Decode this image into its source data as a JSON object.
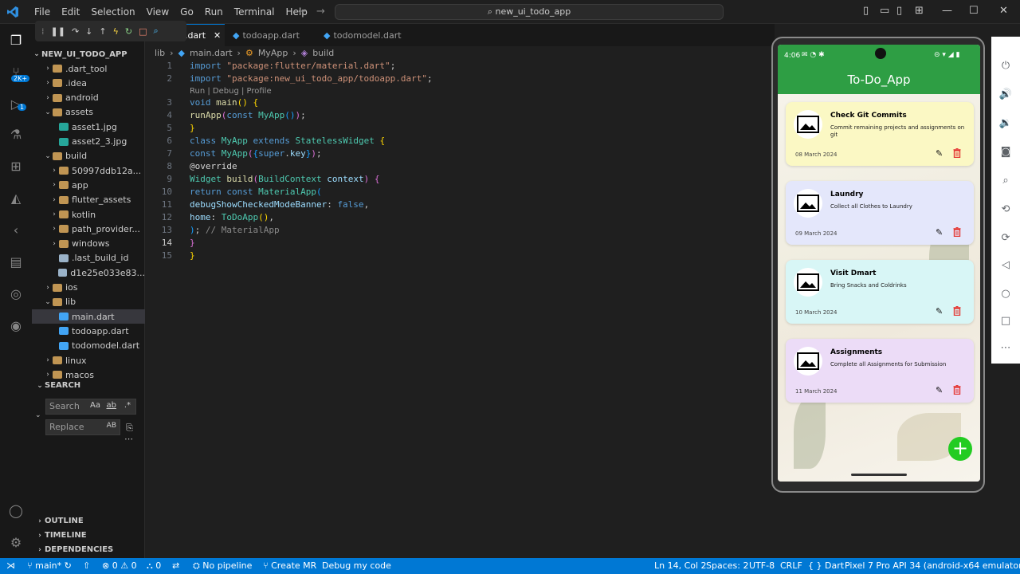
{
  "titlebar": {
    "menu": [
      "File",
      "Edit",
      "Selection",
      "View",
      "Go",
      "Run",
      "Terminal",
      "Help"
    ],
    "command_center": "new_ui_todo_app",
    "back": "←",
    "forward": "→"
  },
  "activity": {
    "badge_scm": "2K+",
    "badge_run": "1"
  },
  "explorer": {
    "root": "NEW_UI_TODO_APP",
    "items": [
      {
        "label": ".dart_tool",
        "depth": 1,
        "folder": true,
        "open": false
      },
      {
        "label": ".idea",
        "depth": 1,
        "folder": true,
        "open": false
      },
      {
        "label": "android",
        "depth": 1,
        "folder": true,
        "open": false
      },
      {
        "label": "assets",
        "depth": 1,
        "folder": true,
        "open": true
      },
      {
        "label": "asset1.jpg",
        "depth": 2,
        "folder": false
      },
      {
        "label": "asset2_3.jpg",
        "depth": 2,
        "folder": false
      },
      {
        "label": "build",
        "depth": 1,
        "folder": true,
        "open": true
      },
      {
        "label": "50997ddb12a...",
        "depth": 2,
        "folder": true,
        "open": false
      },
      {
        "label": "app",
        "depth": 2,
        "folder": true,
        "open": false
      },
      {
        "label": "flutter_assets",
        "depth": 2,
        "folder": true,
        "open": false
      },
      {
        "label": "kotlin",
        "depth": 2,
        "folder": true,
        "open": false
      },
      {
        "label": "path_provider...",
        "depth": 2,
        "folder": true,
        "open": false
      },
      {
        "label": "windows",
        "depth": 2,
        "folder": true,
        "open": false
      },
      {
        "label": ".last_build_id",
        "depth": 2,
        "folder": false
      },
      {
        "label": "d1e25e033e83...",
        "depth": 2,
        "folder": false
      },
      {
        "label": "ios",
        "depth": 1,
        "folder": true,
        "open": false
      },
      {
        "label": "lib",
        "depth": 1,
        "folder": true,
        "open": true
      },
      {
        "label": "main.dart",
        "depth": 2,
        "folder": false,
        "selected": true
      },
      {
        "label": "todoapp.dart",
        "depth": 2,
        "folder": false
      },
      {
        "label": "todomodel.dart",
        "depth": 2,
        "folder": false
      },
      {
        "label": "linux",
        "depth": 1,
        "folder": true,
        "open": false
      },
      {
        "label": "macos",
        "depth": 1,
        "folder": true,
        "open": false
      }
    ]
  },
  "search": {
    "header": "SEARCH",
    "search_placeholder": "Search",
    "replace_placeholder": "Replace",
    "case_btn": "Aa",
    "word_btn": "ab",
    "regex_btn": ".*",
    "preserve_btn": "AB"
  },
  "panels": {
    "outline": "OUTLINE",
    "timeline": "TIMELINE",
    "dependencies": "DEPENDENCIES"
  },
  "tabs": [
    {
      "label": "main.dart",
      "active": true
    },
    {
      "label": "todoapp.dart",
      "active": false
    },
    {
      "label": "todomodel.dart",
      "active": false
    }
  ],
  "breadcrumb": [
    "lib",
    "main.dart",
    "MyApp",
    "build"
  ],
  "code": {
    "codelens": "Run | Debug | Profile",
    "line_numbers": [
      "1",
      "2",
      "3",
      "4",
      "5",
      "6",
      "7",
      "8",
      "9",
      "10",
      "11",
      "12",
      "13",
      "14",
      "15"
    ]
  },
  "statusbar": {
    "branch": "main*",
    "errors": "0",
    "warnings": "0",
    "ports": "0",
    "pipeline": "No pipeline",
    "create_mr": "Create MR",
    "debug": "Debug my code",
    "position": "Ln 14, Col 2",
    "spaces": "Spaces: 2",
    "encoding": "UTF-8",
    "eol": "CRLF",
    "language": "Dart",
    "device": "Pixel 7 Pro API 34 (android-x64 emulator)"
  },
  "phone": {
    "time": "4:06",
    "app_title": "To-Do_App",
    "cards": [
      {
        "title": "Check Git Commits",
        "desc": "Commit remaining projects and assignments on git",
        "date": "08 March 2024",
        "color": "#fbf8c4"
      },
      {
        "title": "Laundry",
        "desc": "Collect all Clothes to Laundry",
        "date": "09 March 2024",
        "color": "#e4e7fb"
      },
      {
        "title": "Visit Dmart",
        "desc": "Bring Snacks and Coldrinks",
        "date": "10 March 2024",
        "color": "#d8f6f6"
      },
      {
        "title": "Assignments",
        "desc": "Complete all Assignments for Submission",
        "date": "11 March 2024",
        "color": "#ecdcf7"
      }
    ],
    "fab": "+"
  },
  "colors": {
    "accent": "#0078d4",
    "appbar": "#2e9e44",
    "fab": "#22cc22",
    "delete": "#e53935"
  }
}
